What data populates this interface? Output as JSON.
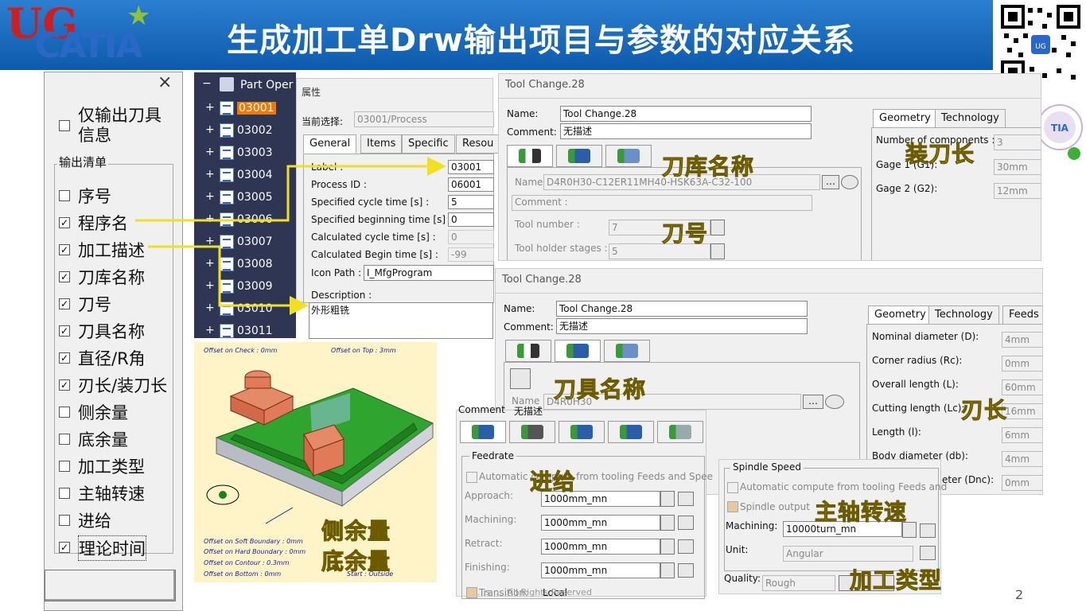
{
  "header": {
    "title": "生成加工单Drw输出项目与参数的对应关系",
    "logo_text_1": "UG",
    "logo_text_2": "CATIA"
  },
  "left_panel": {
    "close": "×",
    "only_tool": "仅输出刀具信息",
    "group_label": "输出清单",
    "items": [
      {
        "label": "序号",
        "checked": false
      },
      {
        "label": "程序名",
        "checked": true
      },
      {
        "label": "加工描述",
        "checked": true
      },
      {
        "label": "刀库名称",
        "checked": true
      },
      {
        "label": "刀号",
        "checked": true
      },
      {
        "label": "刀具名称",
        "checked": true
      },
      {
        "label": "直径/R角",
        "checked": true
      },
      {
        "label": "刃长/装刀长",
        "checked": true
      },
      {
        "label": "侧余量",
        "checked": false
      },
      {
        "label": "底余量",
        "checked": false
      },
      {
        "label": "加工类型",
        "checked": false
      },
      {
        "label": "主轴转速",
        "checked": false
      },
      {
        "label": "进给",
        "checked": false
      },
      {
        "label": "理论时间",
        "checked": true
      }
    ],
    "check_mark": "✓"
  },
  "tree": {
    "root": "Part Oper",
    "items": [
      "03001",
      "03002",
      "03003",
      "03004",
      "03005",
      "03006",
      "03007",
      "03008",
      "03009",
      "03010",
      "03011"
    ]
  },
  "props": {
    "header": "属性",
    "current_label": "当前选择:",
    "current_value": "03001/Process",
    "tabs": [
      "General",
      "Items",
      "Specific",
      "Resou"
    ],
    "rows": [
      {
        "label": "Label :",
        "value": "03001",
        "disabled": false
      },
      {
        "label": "Process ID :",
        "value": "06001",
        "disabled": false
      },
      {
        "label": "Specified cycle time [s] :",
        "value": "5",
        "disabled": false
      },
      {
        "label": "Specified beginning time [s] :",
        "value": "0",
        "disabled": false
      },
      {
        "label": "Calculated cycle time [s] :",
        "value": "0",
        "disabled": true
      },
      {
        "label": "Calculated Begin time [s] :",
        "value": "-99",
        "disabled": true
      }
    ],
    "icon_path_label": "Icon Path :",
    "icon_path_value": "I_MfgProgram",
    "desc_label": "Description :",
    "desc_value": "外形粗铣"
  },
  "tc1": {
    "title": "Tool Change.28",
    "name_label": "Name:",
    "name_value": "Tool Change.28",
    "comment_label": "Comment:",
    "comment_value": "无描述",
    "inner_name_label": "Name:",
    "inner_name_value": "D4R0H30-C12ER11MH40-HSK63A-C32-100",
    "inner_comment_label": "Comment :",
    "tool_number_label": "Tool number :",
    "tool_number_value": "7",
    "holder_label": "Tool holder stages :",
    "holder_value": "5",
    "tabs": [
      "Geometry",
      "Technology"
    ],
    "num_comp_label": "Number of components :",
    "num_comp_value": "3",
    "gage1_label": "Gage 1 (G1):",
    "gage1_value": "30mm",
    "gage2_label": "Gage 2 (G2):",
    "gage2_value": "12mm",
    "ann_lib": "刀库名称",
    "ann_num": "刀号",
    "ann_len": "装刀长"
  },
  "tc2": {
    "title": "Tool Change.28",
    "name_label": "Name:",
    "name_value": "Tool Change.28",
    "comment_label": "Comment:",
    "comment_value": "无描述",
    "inner_name_label": "Name",
    "inner_name_value": "D4R0H30",
    "tabs": [
      "Geometry",
      "Technology",
      "Feeds &"
    ],
    "geo": [
      {
        "label": "Nominal diameter (D):",
        "value": "4mm"
      },
      {
        "label": "Corner radius (Rc):",
        "value": "0mm"
      },
      {
        "label": "Overall length (L):",
        "value": "60mm"
      },
      {
        "label": "Cutting length (Lc):",
        "value": "16mm"
      },
      {
        "label": "Length (l):",
        "value": "6mm"
      },
      {
        "label": "Body diameter (db):",
        "value": "4mm"
      },
      {
        "label": "ameter (Dnc):",
        "value": "0mm"
      }
    ],
    "ann_tool": "刀具名称",
    "ann_cut": "刃长"
  },
  "drawing": {
    "top_left": "Offset on Check : 0mm",
    "top_right": "Offset on Top : 3mm",
    "bottom": [
      "Offset on Soft Boundary : 0mm",
      "Offset on Hard Boundary : 0mm",
      "Offset on Contour : 0.3mm",
      "Offset on Bottom : 0mm"
    ],
    "start": "Start : Outside",
    "ann_side": "侧余量",
    "ann_bottom": "底余量"
  },
  "feed": {
    "comment_partial": "Comment",
    "comment_partial_value": "无描述",
    "group": "Feedrate",
    "automatic": "Automatic compute from tooling Feeds and Spee",
    "rows": [
      {
        "label": "Approach:",
        "value": "1000mm_mn"
      },
      {
        "label": "Machining:",
        "value": "1000mm_mn"
      },
      {
        "label": "Retract:",
        "value": "1000mm_mn"
      },
      {
        "label": "Finishing:",
        "value": "1000mm_mn"
      }
    ],
    "transition_label": "Transition:",
    "transition_value": "Local",
    "ann": "进给"
  },
  "spindle": {
    "group": "Spindle Speed",
    "automatic": "Automatic compute from tooling Feeds and",
    "output": "Spindle output",
    "machining_label": "Machining:",
    "machining_value": "10000turn_mn",
    "unit_label": "Unit:",
    "unit_value": "Angular",
    "quality_label": "Quality:",
    "quality_value": "Rough",
    "ann_speed": "主轴转速",
    "ann_type": "加工类型"
  },
  "footer": {
    "copyright": "...s: ...,All Rights Reserved",
    "page": "2"
  }
}
